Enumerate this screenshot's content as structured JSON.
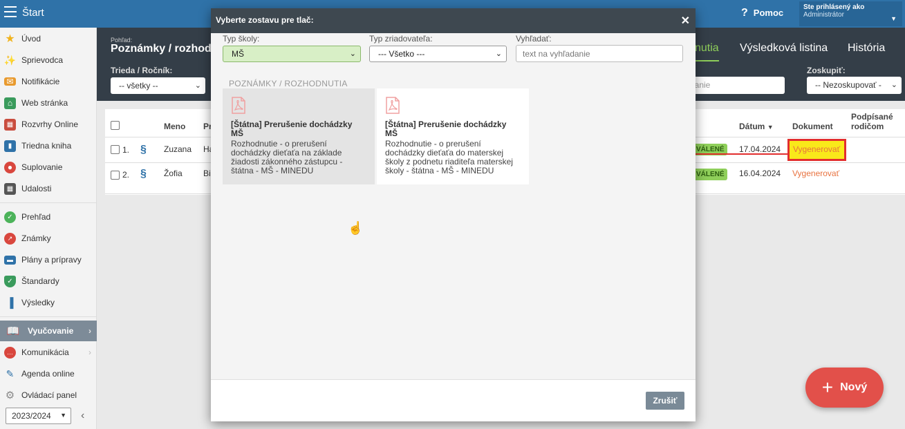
{
  "topbar": {
    "start": "Štart",
    "help": "Pomoc",
    "user_line1": "Ste prihlásený ako",
    "user_line2": "Administrátor"
  },
  "sidebar": {
    "items": [
      {
        "label": "Úvod",
        "icon": "star-icon",
        "color": "#f1b31c"
      },
      {
        "label": "Sprievodca",
        "icon": "wand-icon",
        "color": "#e2504a"
      },
      {
        "label": "Notifikácie",
        "icon": "envelope-icon",
        "color": "#e89a2e"
      },
      {
        "label": "Web stránka",
        "icon": "house-icon",
        "color": "#3a9b5c"
      },
      {
        "label": "Rozvrhy Online",
        "icon": "grid-icon",
        "color": "#c94d3e"
      },
      {
        "label": "Triedna kniha",
        "icon": "book-icon",
        "color": "#2f72a8"
      },
      {
        "label": "Suplovanie",
        "icon": "person-icon",
        "color": "#d9473e"
      },
      {
        "label": "Udalosti",
        "icon": "calendar-icon",
        "color": "#555"
      },
      {
        "label": "Prehľad",
        "icon": "check-circle-icon",
        "color": "#4cb35a"
      },
      {
        "label": "Známky",
        "icon": "chart-circle-icon",
        "color": "#d9473e"
      },
      {
        "label": "Plány a prípravy",
        "icon": "briefcase-icon",
        "color": "#2f72a8"
      },
      {
        "label": "Štandardy",
        "icon": "shield-icon",
        "color": "#3a9b5c"
      },
      {
        "label": "Výsledky",
        "icon": "bar-chart-icon",
        "color": "#2f72a8"
      },
      {
        "label": "Vyučovanie",
        "icon": "open-book-icon",
        "color": "#fff"
      },
      {
        "label": "Komunikácia",
        "icon": "chat-icon",
        "color": "#d9473e"
      },
      {
        "label": "Agenda online",
        "icon": "pen-icon",
        "color": "#2f72a8"
      },
      {
        "label": "Ovládací panel",
        "icon": "gear-icon",
        "color": "#888"
      }
    ],
    "year": "2023/2024"
  },
  "header": {
    "view_label": "Pohľad:",
    "title": "Poznámky / rozhod",
    "class_label": "Trieda / Ročník:",
    "class_value": "-- všetky --",
    "tabs": [
      "nutia",
      "Výsledková listina",
      "História"
    ],
    "group_label": "Zoskupiť:",
    "group_value": "-- Nezoskupovať -",
    "search_partial": "lanie"
  },
  "table": {
    "headers": {
      "name": "Meno",
      "p": "Pr",
      "date": "Dátum",
      "document": "Dokument",
      "signed_line1": "Podpísané",
      "signed_line2": "rodičom"
    },
    "rows": [
      {
        "num": "1.",
        "name": "Zuzana",
        "p": "Ha",
        "status": "VÁLENÉ",
        "date": "17.04.2024",
        "doc": "Vygenerovať"
      },
      {
        "num": "2.",
        "name": "Žofia",
        "p": "Bi",
        "status": "VÁLENÉ",
        "date": "16.04.2024",
        "doc": "Vygenerovať"
      }
    ]
  },
  "fab": {
    "label": "Nový"
  },
  "modal": {
    "title": "Vyberte zostavu pre tlač:",
    "filters": {
      "school_type_label": "Typ školy:",
      "school_type_value": "MŠ",
      "founder_label": "Typ zriadovateľa:",
      "founder_value": "--- Všetko ---",
      "search_label": "Vyhľadať:",
      "search_placeholder": "text na vyhľadanie"
    },
    "section": "POZNÁMKY / ROZHODNUTIA",
    "cards": [
      {
        "title": "[Štátna] Prerušenie dochádzky MŠ",
        "desc": "Rozhodnutie - o prerušení dochádzky dieťaťa na základe žiadosti zákonného zástupcu - štátna - MŠ - MINEDU"
      },
      {
        "title": "[Štátna] Prerušenie dochádzky MŠ",
        "desc": "Rozhodnutie - o prerušení dochádzky dieťaťa do materskej školy z podnetu riaditeľa materskej školy - štátna - MŠ - MINEDU"
      }
    ],
    "cancel": "Zrušiť"
  }
}
